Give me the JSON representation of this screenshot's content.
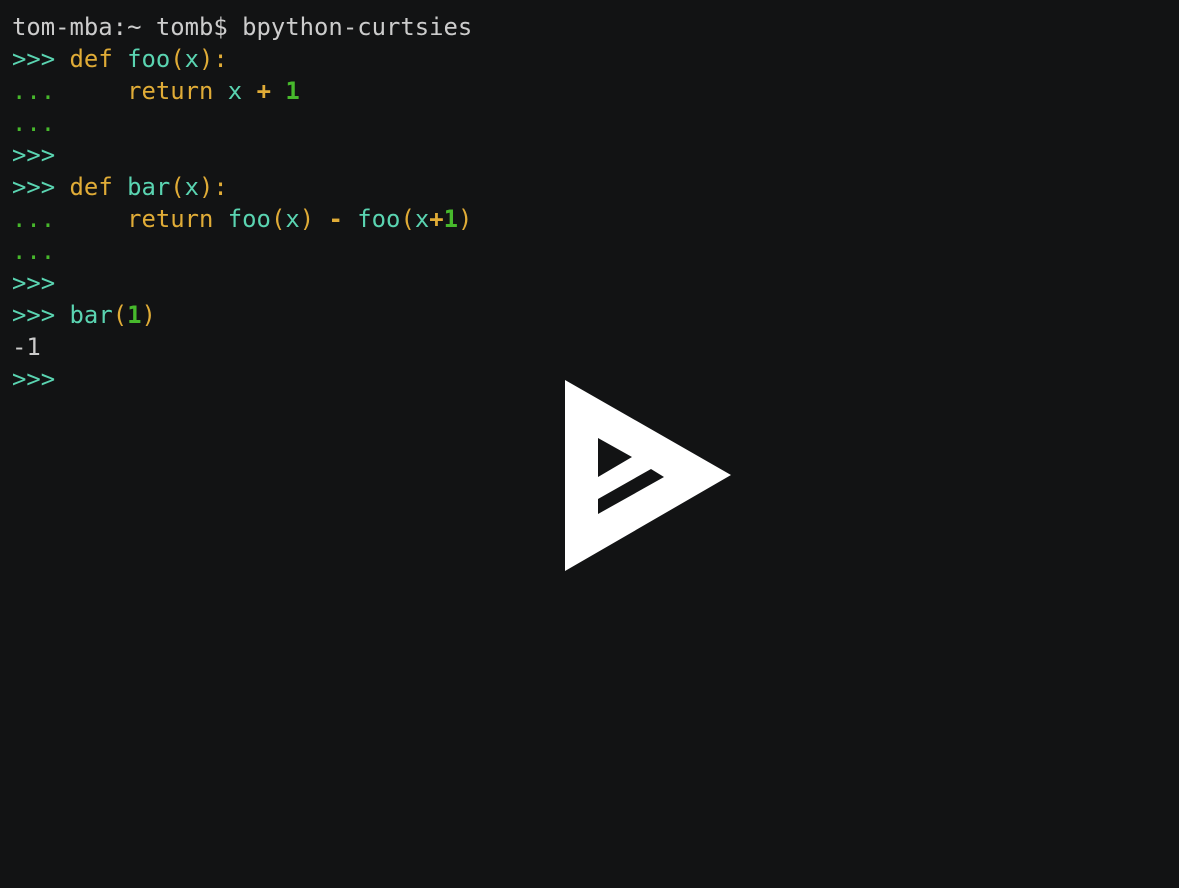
{
  "palette": {
    "background": "#121314",
    "default": "#cccccc",
    "prompt": "#5ad4b1",
    "continuation": "#47b92c",
    "keyword": "#e0ac37",
    "name": "#5ad4b1",
    "paren": "#e0ac37",
    "operator": "#e0ac37",
    "number": "#47b92c",
    "play_icon": "#ffffff"
  },
  "terminal": {
    "lines": [
      {
        "segments": [
          {
            "text": "tom-mba:~ tomb$ bpython-curtsies",
            "role": "default"
          }
        ]
      },
      {
        "segments": [
          {
            "text": ">>>",
            "role": "prompt"
          },
          {
            "text": " ",
            "role": "default"
          },
          {
            "text": "def",
            "role": "keyword"
          },
          {
            "text": " ",
            "role": "default"
          },
          {
            "text": "foo",
            "role": "name"
          },
          {
            "text": "(",
            "role": "paren"
          },
          {
            "text": "x",
            "role": "name"
          },
          {
            "text": "):",
            "role": "paren"
          }
        ]
      },
      {
        "segments": [
          {
            "text": "...",
            "role": "continuation"
          },
          {
            "text": "     ",
            "role": "default"
          },
          {
            "text": "return",
            "role": "keyword"
          },
          {
            "text": " ",
            "role": "default"
          },
          {
            "text": "x",
            "role": "name"
          },
          {
            "text": " ",
            "role": "default"
          },
          {
            "text": "+",
            "role": "operator",
            "bold": true
          },
          {
            "text": " ",
            "role": "default"
          },
          {
            "text": "1",
            "role": "number",
            "bold": true
          }
        ]
      },
      {
        "segments": [
          {
            "text": "...",
            "role": "continuation"
          }
        ]
      },
      {
        "segments": [
          {
            "text": ">>>",
            "role": "prompt"
          }
        ]
      },
      {
        "segments": [
          {
            "text": ">>>",
            "role": "prompt"
          },
          {
            "text": " ",
            "role": "default"
          },
          {
            "text": "def",
            "role": "keyword"
          },
          {
            "text": " ",
            "role": "default"
          },
          {
            "text": "bar",
            "role": "name"
          },
          {
            "text": "(",
            "role": "paren"
          },
          {
            "text": "x",
            "role": "name"
          },
          {
            "text": "):",
            "role": "paren"
          }
        ]
      },
      {
        "segments": [
          {
            "text": "...",
            "role": "continuation"
          },
          {
            "text": "     ",
            "role": "default"
          },
          {
            "text": "return",
            "role": "keyword"
          },
          {
            "text": " ",
            "role": "default"
          },
          {
            "text": "foo",
            "role": "name"
          },
          {
            "text": "(",
            "role": "paren"
          },
          {
            "text": "x",
            "role": "name"
          },
          {
            "text": ")",
            "role": "paren"
          },
          {
            "text": " ",
            "role": "default"
          },
          {
            "text": "-",
            "role": "operator",
            "bold": true
          },
          {
            "text": " ",
            "role": "default"
          },
          {
            "text": "foo",
            "role": "name"
          },
          {
            "text": "(",
            "role": "paren"
          },
          {
            "text": "x",
            "role": "name"
          },
          {
            "text": "+",
            "role": "operator",
            "bold": true
          },
          {
            "text": "1",
            "role": "number",
            "bold": true
          },
          {
            "text": ")",
            "role": "paren"
          }
        ]
      },
      {
        "segments": [
          {
            "text": "...",
            "role": "continuation"
          }
        ]
      },
      {
        "segments": [
          {
            "text": ">>>",
            "role": "prompt"
          }
        ]
      },
      {
        "segments": [
          {
            "text": ">>>",
            "role": "prompt"
          },
          {
            "text": " ",
            "role": "default"
          },
          {
            "text": "bar",
            "role": "name"
          },
          {
            "text": "(",
            "role": "paren"
          },
          {
            "text": "1",
            "role": "number",
            "bold": true
          },
          {
            "text": ")",
            "role": "paren"
          }
        ]
      },
      {
        "segments": [
          {
            "text": "-1",
            "role": "default"
          }
        ]
      },
      {
        "segments": [
          {
            "text": ">>>",
            "role": "prompt"
          }
        ]
      }
    ]
  },
  "overlay": {
    "icon": "asciinema-play-icon"
  }
}
